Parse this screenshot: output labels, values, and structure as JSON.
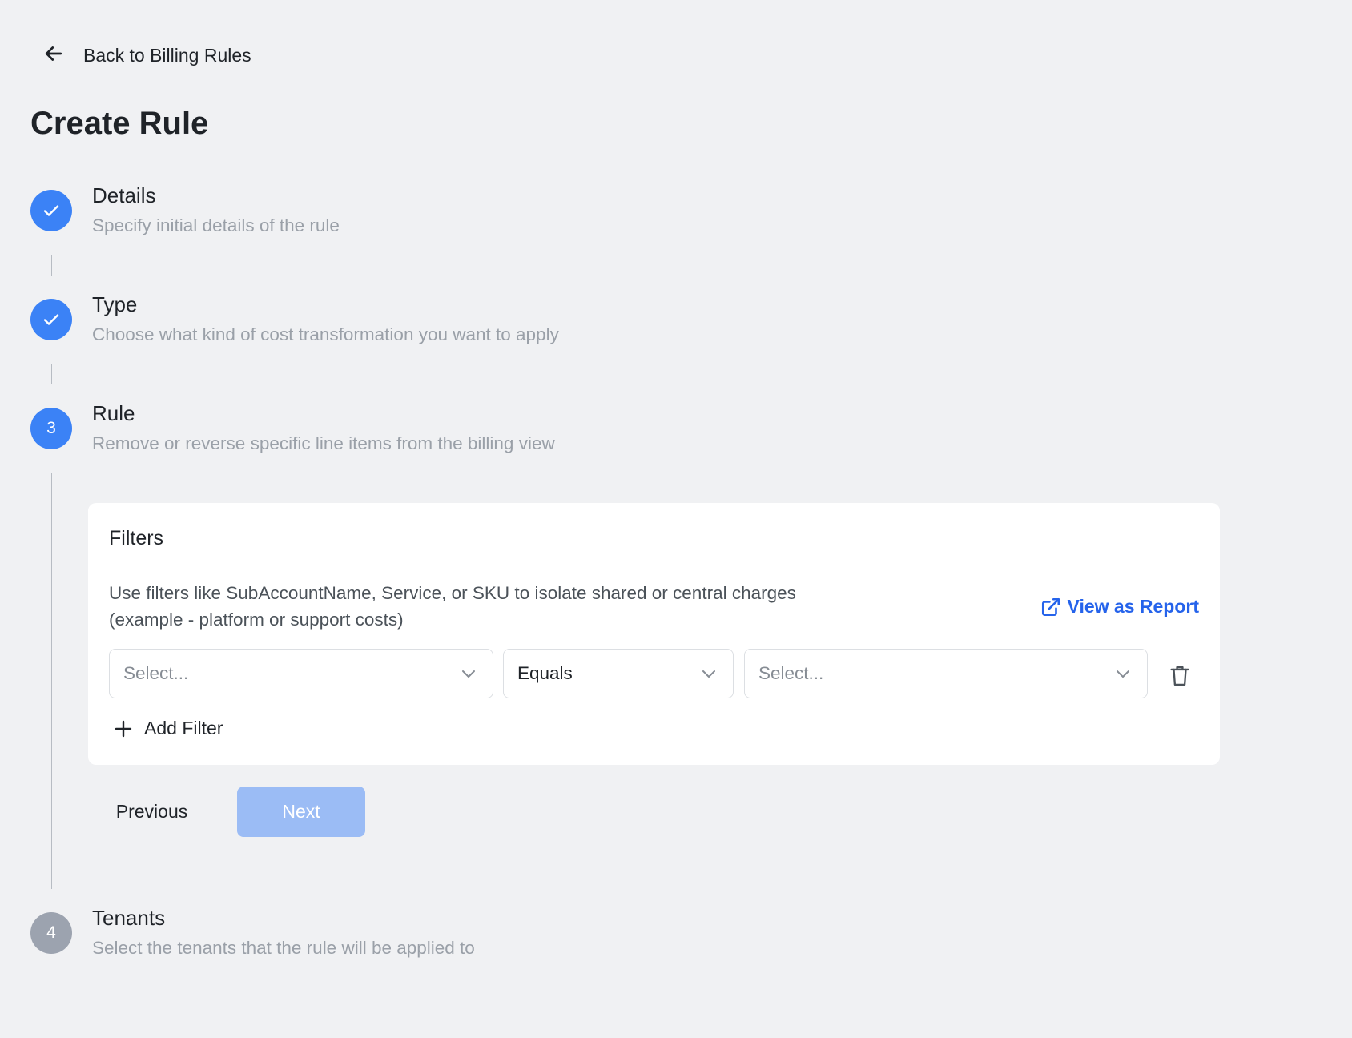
{
  "header": {
    "back_label": "Back to Billing Rules",
    "title": "Create Rule"
  },
  "steps": [
    {
      "title": "Details",
      "description": "Specify initial details of the rule",
      "status": "done",
      "number": "1"
    },
    {
      "title": "Type",
      "description": "Choose what kind of cost transformation you want to apply",
      "status": "done",
      "number": "2"
    },
    {
      "title": "Rule",
      "description": "Remove or reverse specific line items from the billing view",
      "status": "active",
      "number": "3"
    },
    {
      "title": "Tenants",
      "description": "Select the tenants that the rule will be applied to",
      "status": "pending",
      "number": "4"
    }
  ],
  "filters": {
    "title": "Filters",
    "description_line1": "Use filters like SubAccountName, Service, or SKU to isolate shared or central charges",
    "description_line2": "(example - platform or support costs)",
    "view_report_label": "View as Report",
    "field_select_placeholder": "Select...",
    "operator_value": "Equals",
    "value_select_placeholder": "Select...",
    "add_filter_label": "Add Filter"
  },
  "actions": {
    "previous_label": "Previous",
    "next_label": "Next"
  },
  "colors": {
    "accent": "#3b82f6",
    "link": "#2563eb",
    "next_disabled": "#9bbcf5",
    "pending_step": "#9ca3af",
    "background": "#f0f1f3"
  },
  "icons": {
    "back": "arrow-left-icon",
    "done": "check-icon",
    "external": "external-link-icon",
    "chevron": "chevron-down-icon",
    "trash": "trash-icon",
    "add": "plus-icon"
  }
}
